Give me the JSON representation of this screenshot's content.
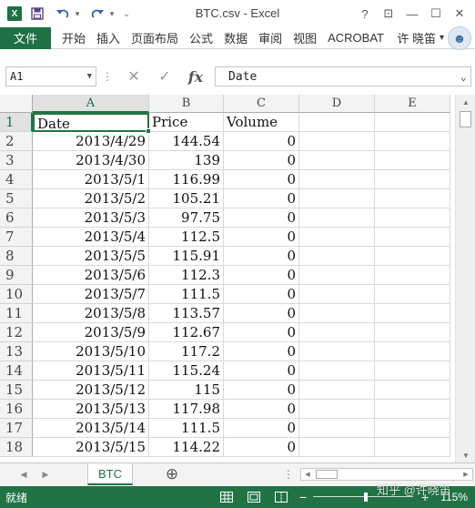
{
  "window": {
    "title": "BTC.csv - Excel",
    "logo_letter": "X",
    "buttons": [
      "?",
      "⊡",
      "—",
      "☐",
      "✕"
    ]
  },
  "quick_access": {
    "save_icon": "save-icon",
    "undo_icon": "undo-icon",
    "redo_icon": "redo-icon",
    "customize_icon": "customize-icon"
  },
  "ribbon": {
    "file_tab": "文件",
    "tabs": [
      "开始",
      "插入",
      "页面布局",
      "公式",
      "数据",
      "审阅",
      "视图",
      "ACROBAT"
    ],
    "user_name": "许 晓笛",
    "user_dropdown": "▾"
  },
  "formula_bar": {
    "name_box": "A1",
    "cancel": "✕",
    "enter": "✓",
    "fx": "fx",
    "content": "Date"
  },
  "grid": {
    "columns": [
      "A",
      "B",
      "C",
      "D",
      "E"
    ],
    "selected_column": "A",
    "selected_row": 1,
    "rows": [
      {
        "num": "1",
        "a": "Date",
        "b": "Price",
        "c": "Volume"
      },
      {
        "num": "2",
        "a": "2013/4/29",
        "b": "144.54",
        "c": "0"
      },
      {
        "num": "3",
        "a": "2013/4/30",
        "b": "139",
        "c": "0"
      },
      {
        "num": "4",
        "a": "2013/5/1",
        "b": "116.99",
        "c": "0"
      },
      {
        "num": "5",
        "a": "2013/5/2",
        "b": "105.21",
        "c": "0"
      },
      {
        "num": "6",
        "a": "2013/5/3",
        "b": "97.75",
        "c": "0"
      },
      {
        "num": "7",
        "a": "2013/5/4",
        "b": "112.5",
        "c": "0"
      },
      {
        "num": "8",
        "a": "2013/5/5",
        "b": "115.91",
        "c": "0"
      },
      {
        "num": "9",
        "a": "2013/5/6",
        "b": "112.3",
        "c": "0"
      },
      {
        "num": "10",
        "a": "2013/5/7",
        "b": "111.5",
        "c": "0"
      },
      {
        "num": "11",
        "a": "2013/5/8",
        "b": "113.57",
        "c": "0"
      },
      {
        "num": "12",
        "a": "2013/5/9",
        "b": "112.67",
        "c": "0"
      },
      {
        "num": "13",
        "a": "2013/5/10",
        "b": "117.2",
        "c": "0"
      },
      {
        "num": "14",
        "a": "2013/5/11",
        "b": "115.24",
        "c": "0"
      },
      {
        "num": "15",
        "a": "2013/5/12",
        "b": "115",
        "c": "0"
      },
      {
        "num": "16",
        "a": "2013/5/13",
        "b": "117.98",
        "c": "0"
      },
      {
        "num": "17",
        "a": "2013/5/14",
        "b": "111.5",
        "c": "0"
      },
      {
        "num": "18",
        "a": "2013/5/15",
        "b": "114.22",
        "c": "0"
      }
    ]
  },
  "sheets": {
    "active": "BTC",
    "add_label": "⊕"
  },
  "status_bar": {
    "ready": "就绪",
    "zoom": "115%",
    "zoom_level_percent": 115
  },
  "watermark": "知乎 @许晓笛",
  "colors": {
    "excel_green": "#217346",
    "title_green": "#1e7145"
  }
}
